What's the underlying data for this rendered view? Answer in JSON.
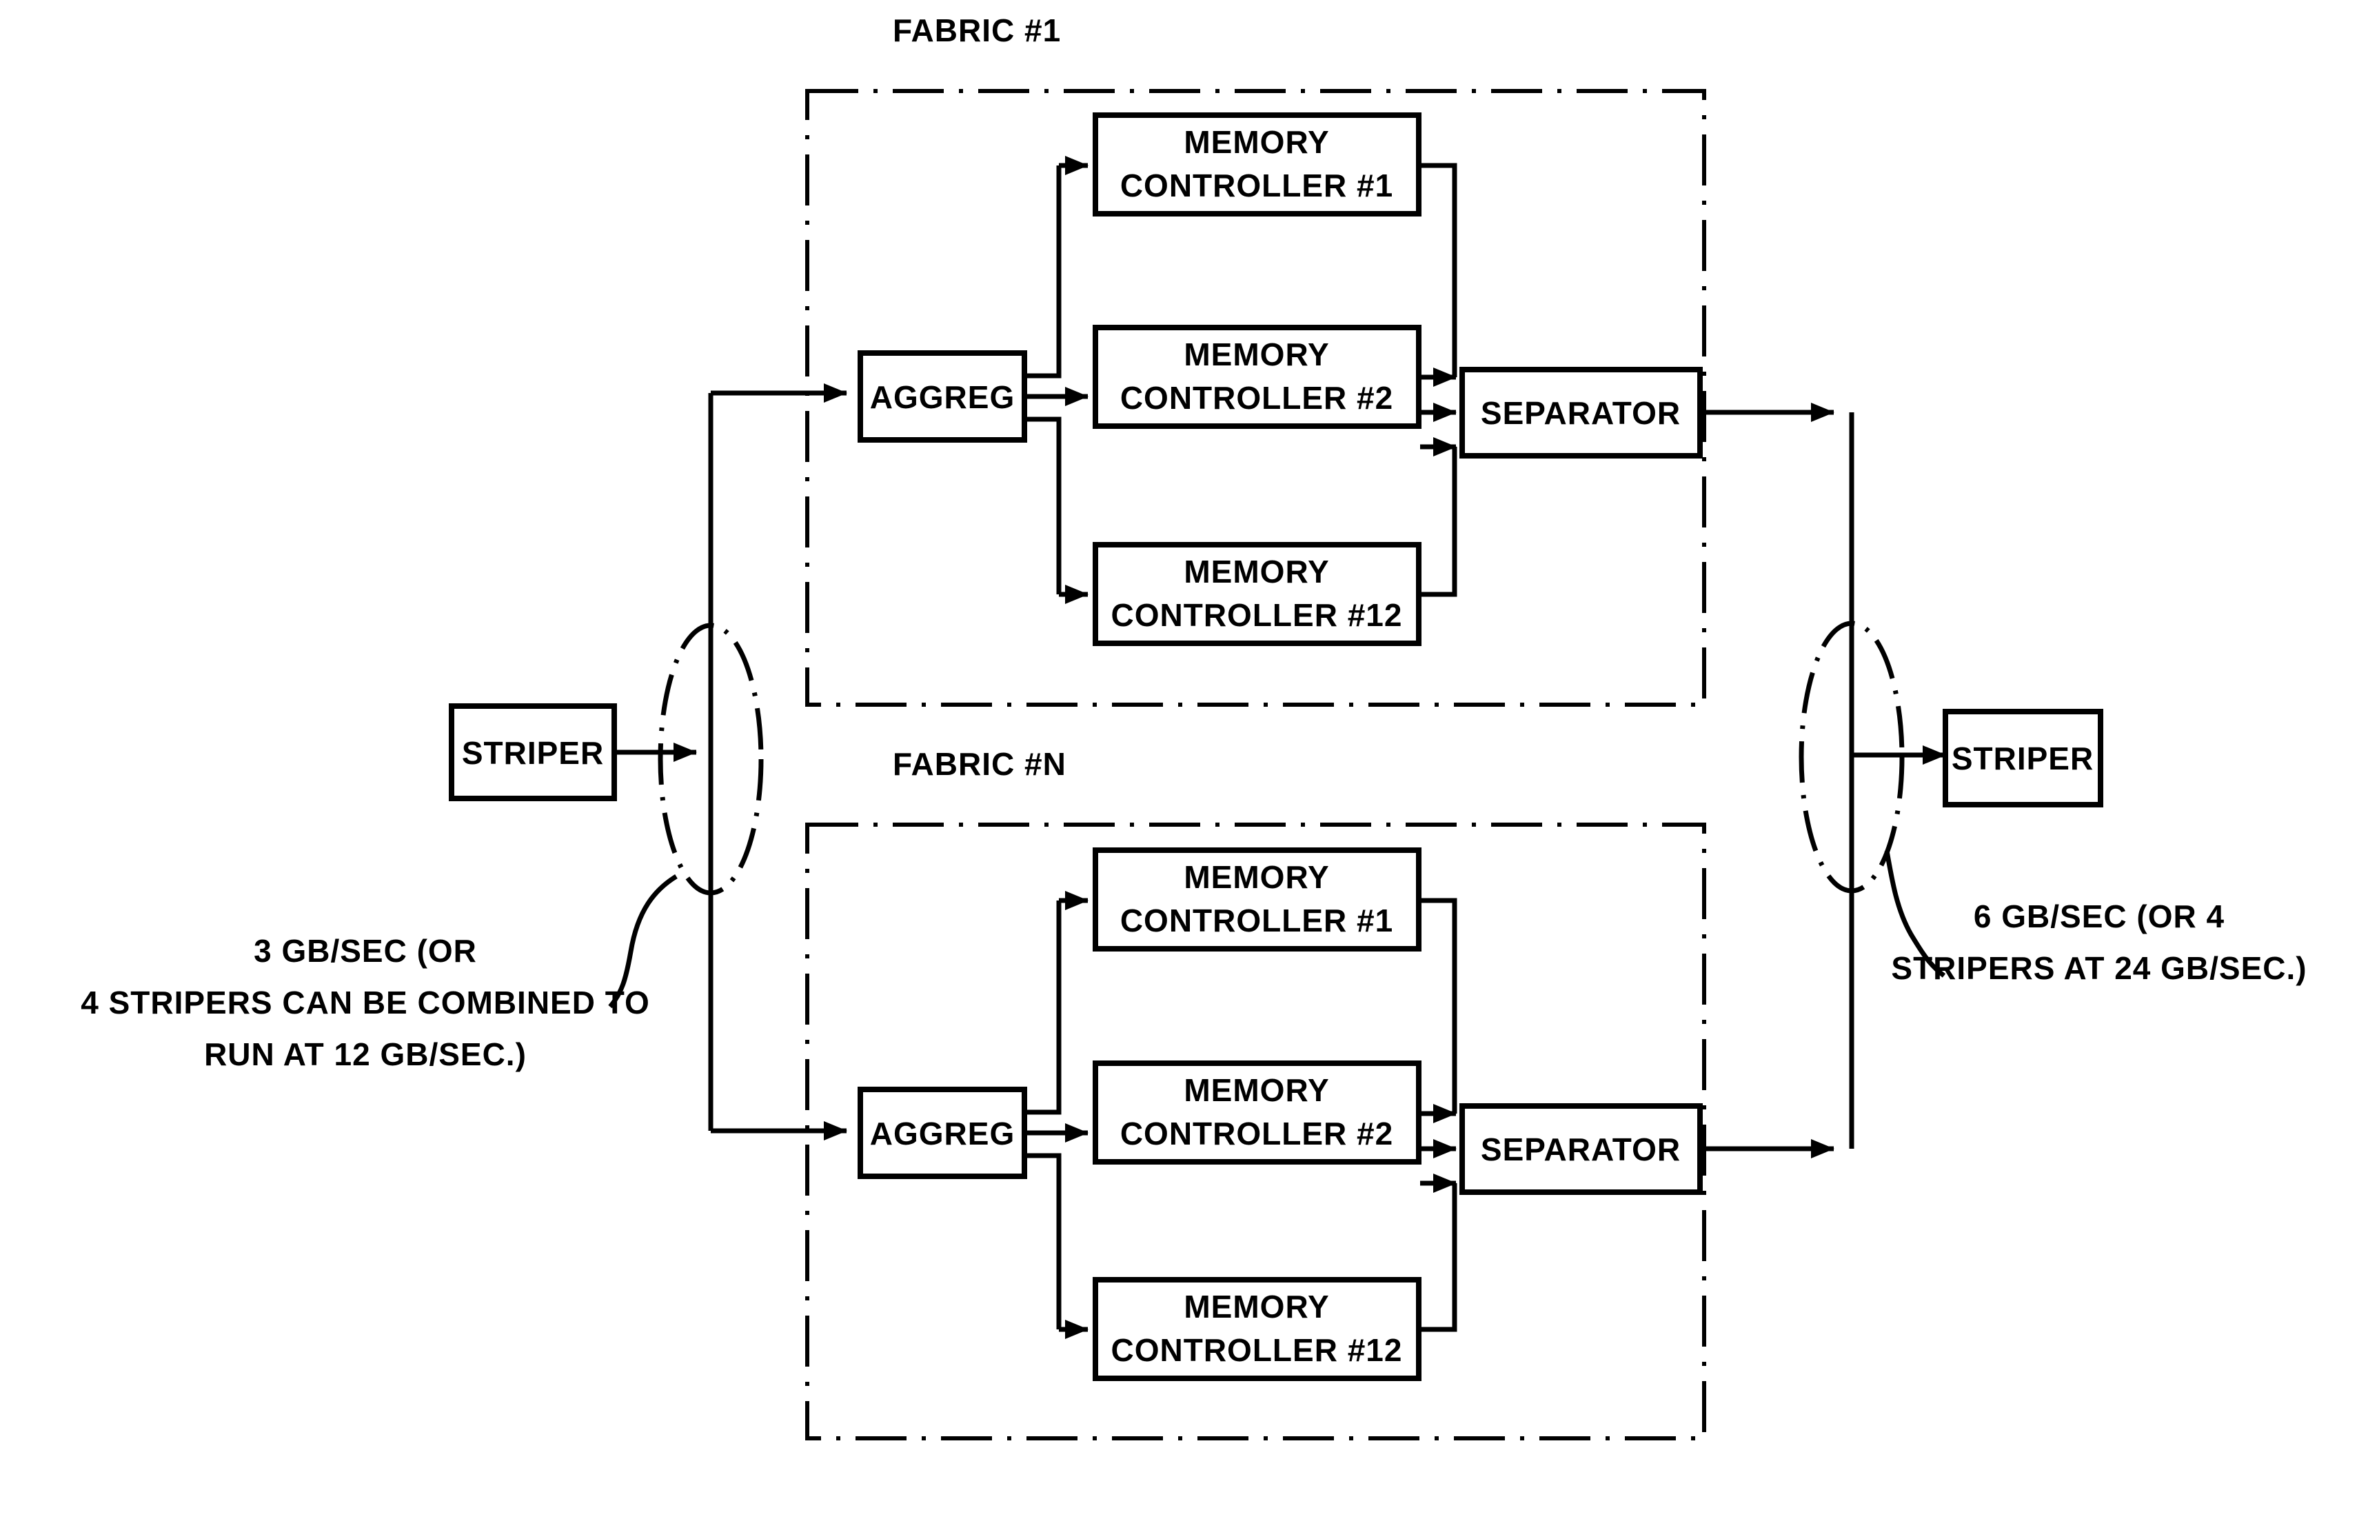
{
  "figure": {
    "title": "Striped memory fabric block diagram",
    "ink_color": "#000000",
    "background_color": "#ffffff"
  },
  "endpoints": {
    "input_striper_label": "STRIPER",
    "output_striper_label": "STRIPER"
  },
  "captions": {
    "left": {
      "line1": "3 GB/SEC (OR",
      "line2": "4 STRIPERS CAN BE COMBINED TO",
      "line3": "RUN AT 12 GB/SEC.)"
    },
    "right": {
      "line1": "6 GB/SEC (OR 4",
      "line2": "STRIPERS AT 24 GB/SEC.)"
    }
  },
  "fabrics": [
    {
      "label": "FABRIC #1",
      "aggregator_label": "AGGREG",
      "separator_label": "SEPARATOR",
      "memory_controllers": [
        {
          "line1": "MEMORY",
          "line2": "CONTROLLER #1"
        },
        {
          "line1": "MEMORY",
          "line2": "CONTROLLER #2"
        },
        {
          "line1": "MEMORY",
          "line2": "CONTROLLER #12"
        }
      ]
    },
    {
      "label": "FABRIC #N",
      "aggregator_label": "AGGREG",
      "separator_label": "SEPARATOR",
      "memory_controllers": [
        {
          "line1": "MEMORY",
          "line2": "CONTROLLER #1"
        },
        {
          "line1": "MEMORY",
          "line2": "CONTROLLER #2"
        },
        {
          "line1": "MEMORY",
          "line2": "CONTROLLER #12"
        }
      ]
    }
  ]
}
